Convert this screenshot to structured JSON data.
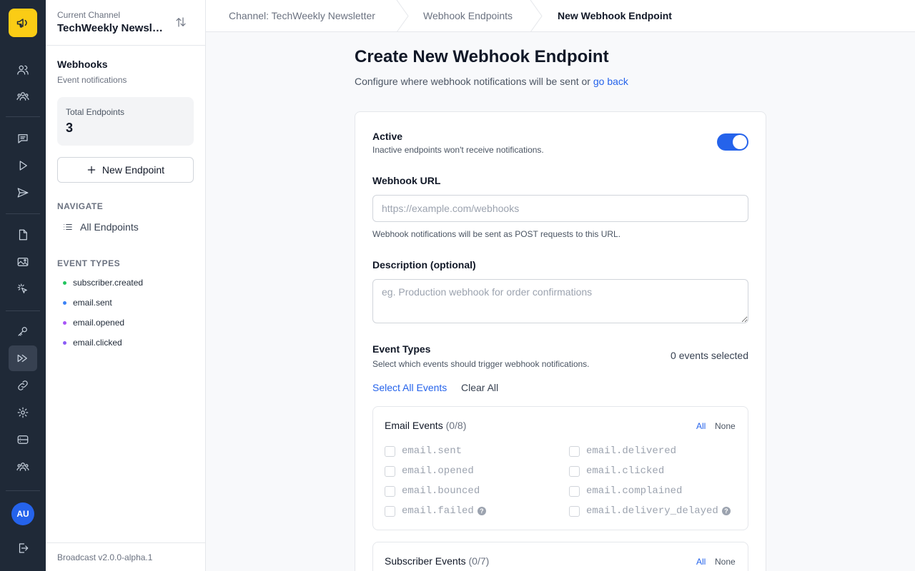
{
  "rail": {
    "logo_icon": "megaphone-icon",
    "avatar_initials": "AU",
    "accent": "#facc15"
  },
  "sidebar": {
    "channel_caption": "Current Channel",
    "channel_name": "TechWeekly Newsletter",
    "title": "Webhooks",
    "subtitle": "Event notifications",
    "stat_label": "Total Endpoints",
    "stat_value": "3",
    "new_endpoint_label": "New Endpoint",
    "navigate_label": "NAVIGATE",
    "all_endpoints_label": "All Endpoints",
    "event_types_label": "EVENT TYPES",
    "event_types": [
      {
        "label": "subscriber.created",
        "color": "#22c55e"
      },
      {
        "label": "email.sent",
        "color": "#3b82f6"
      },
      {
        "label": "email.opened",
        "color": "#a855f7"
      },
      {
        "label": "email.clicked",
        "color": "#8b5cf6"
      }
    ],
    "version": "Broadcast v2.0.0-alpha.1"
  },
  "breadcrumb": [
    "Channel: TechWeekly Newsletter",
    "Webhook Endpoints",
    "New Webhook Endpoint"
  ],
  "main": {
    "title": "Create New Webhook Endpoint",
    "lead_text": "Configure where webhook notifications will be sent or ",
    "lead_link": "go back",
    "active_label": "Active",
    "active_hint": "Inactive endpoints won't receive notifications.",
    "active_on": true,
    "url_label": "Webhook URL",
    "url_placeholder": "https://example.com/webhooks",
    "url_hint": "Webhook notifications will be sent as POST requests to this URL.",
    "desc_label": "Description (optional)",
    "desc_placeholder": "eg. Production webhook for order confirmations",
    "events_label": "Event Types",
    "events_hint": "Select which events should trigger webhook notifications.",
    "events_count": "0 events selected",
    "select_all": "Select All Events",
    "clear_all": "Clear All",
    "groups": [
      {
        "title": "Email Events",
        "count": "(0/8)",
        "all": "All",
        "none": "None",
        "items": [
          "email.sent",
          "email.delivered",
          "email.opened",
          "email.clicked",
          "email.bounced",
          "email.complained",
          "email.failed",
          "email.delivery_delayed"
        ]
      },
      {
        "title": "Subscriber Events",
        "count": "(0/7)",
        "all": "All",
        "none": "None"
      }
    ]
  }
}
